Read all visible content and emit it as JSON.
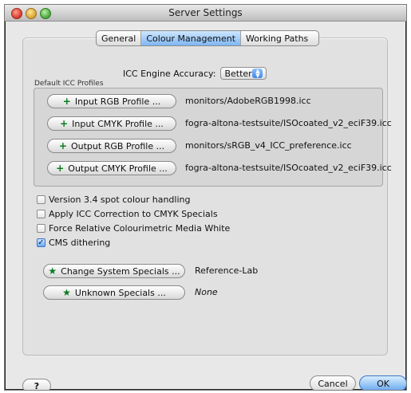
{
  "window": {
    "title": "Server Settings"
  },
  "tabs": [
    "General",
    "Colour Management",
    "Working Paths"
  ],
  "selected_tab": "Colour Management",
  "engine": {
    "label": "ICC Engine Accuracy:",
    "value": "Better"
  },
  "profiles": {
    "group_title": "Default ICC Profiles",
    "items": [
      {
        "button": "Input RGB Profile ...",
        "value": "monitors/AdobeRGB1998.icc"
      },
      {
        "button": "Input CMYK Profile ...",
        "value": "fogra-altona-testsuite/ISOcoated_v2_eciF39.icc"
      },
      {
        "button": "Output RGB Profile ...",
        "value": "monitors/sRGB_v4_ICC_preference.icc"
      },
      {
        "button": "Output CMYK Profile ...",
        "value": "fogra-altona-testsuite/ISOcoated_v2_eciF39.icc"
      }
    ]
  },
  "options": [
    {
      "label": "Version 3.4 spot colour handling",
      "checked": false
    },
    {
      "label": "Apply ICC Correction to CMYK Specials",
      "checked": false
    },
    {
      "label": "Force Relative Colourimetric Media White",
      "checked": false
    },
    {
      "label": "CMS dithering",
      "checked": true
    }
  ],
  "specials": [
    {
      "button": "Change System Specials ...",
      "value": "Reference-Lab",
      "italic": false
    },
    {
      "button": "Unknown Specials ...",
      "value": "None",
      "italic": true
    }
  ],
  "footer": {
    "help": "?",
    "cancel": "Cancel",
    "ok": "OK"
  },
  "icons": {
    "plus": "plus-icon",
    "star": "star-icon",
    "help": "help-icon",
    "select_arrows": "updown-arrows-icon",
    "checkmark": "checkmark-icon"
  },
  "colors": {
    "accent_blue": "#6aa9ef",
    "accent_green": "#0a7b1e"
  }
}
